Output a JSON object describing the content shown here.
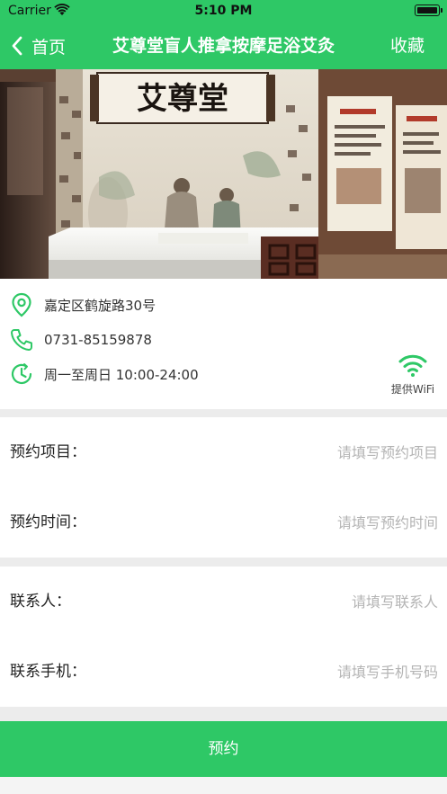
{
  "status_bar": {
    "carrier": "Carrier",
    "time": "5:10 PM"
  },
  "nav": {
    "back_label": "首页",
    "title": "艾尊堂盲人推拿按摩足浴艾灸",
    "favorite_label": "收藏"
  },
  "hero": {
    "sign_text": "艾尊堂"
  },
  "info": {
    "address": "嘉定区鹤旋路30号",
    "phone": "0731-85159878",
    "hours": "周一至周日 10:00-24:00",
    "wifi_label": "提供WiFi"
  },
  "form": {
    "booking": [
      {
        "label": "预约项目：",
        "placeholder": "请填写预约项目",
        "value": ""
      },
      {
        "label": "预约时间：",
        "placeholder": "请填写预约时间",
        "value": ""
      }
    ],
    "contact": [
      {
        "label": "联系人：",
        "placeholder": "请填写联系人",
        "value": ""
      },
      {
        "label": "联系手机：",
        "placeholder": "请填写手机号码",
        "value": ""
      }
    ]
  },
  "submit_label": "预约",
  "colors": {
    "accent": "#2ec866",
    "background": "#ececec"
  }
}
